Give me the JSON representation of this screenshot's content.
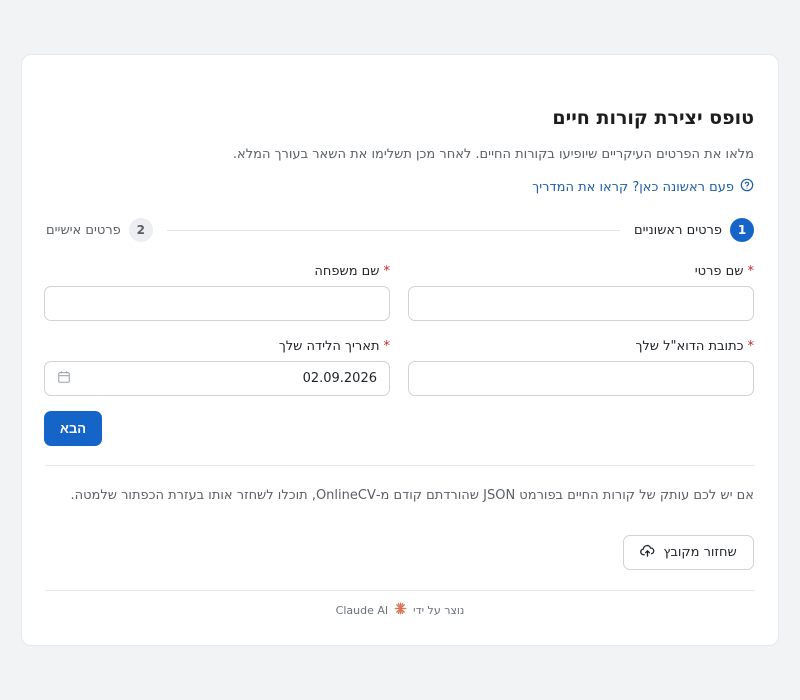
{
  "form": {
    "title": "טופס יצירת קורות חיים",
    "subtitle": "מלאו את הפרטים העיקריים שיופיעו בקורות החיים. לאחר מכן תשלימו את השאר בעורך המלא.",
    "guide_link": "פעם ראשונה כאן? קראו את המדריך"
  },
  "steps": [
    {
      "number": "1",
      "label": "פרטים ראשוניים",
      "active": true
    },
    {
      "number": "2",
      "label": "פרטים אישיים",
      "active": false
    }
  ],
  "fields": {
    "first_name": {
      "label": "שם פרטי",
      "required_mark": "*",
      "value": ""
    },
    "last_name": {
      "label": "שם משפחה",
      "required_mark": "*",
      "value": ""
    },
    "email": {
      "label": "כתובת הדוא\"ל שלך",
      "required_mark": "*",
      "value": ""
    },
    "birth_date": {
      "label": "תאריך הלידה שלך",
      "required_mark": "*",
      "value": "02.09.2026"
    }
  },
  "actions": {
    "next_label": "הבא"
  },
  "import": {
    "text": "אם יש לכם עותק של קורות החיים בפורמט JSON שהורדתם קודם מ-OnlineCV, תוכלו לשחזר אותו בעזרת הכפתור שלמטה.",
    "restore_label": "שחזור מקובץ"
  },
  "footer": {
    "made_by": "נוצר על ידי",
    "brand": "Claude AI"
  },
  "colors": {
    "accent": "#1565c8",
    "link": "#1f5ea8",
    "required": "#c62828",
    "claude_brand": "#d97757"
  },
  "icons": {
    "guide": "question-circle-icon",
    "date": "calendar-icon",
    "restore": "cloud-upload-icon",
    "footer": "claude-spark-icon"
  }
}
